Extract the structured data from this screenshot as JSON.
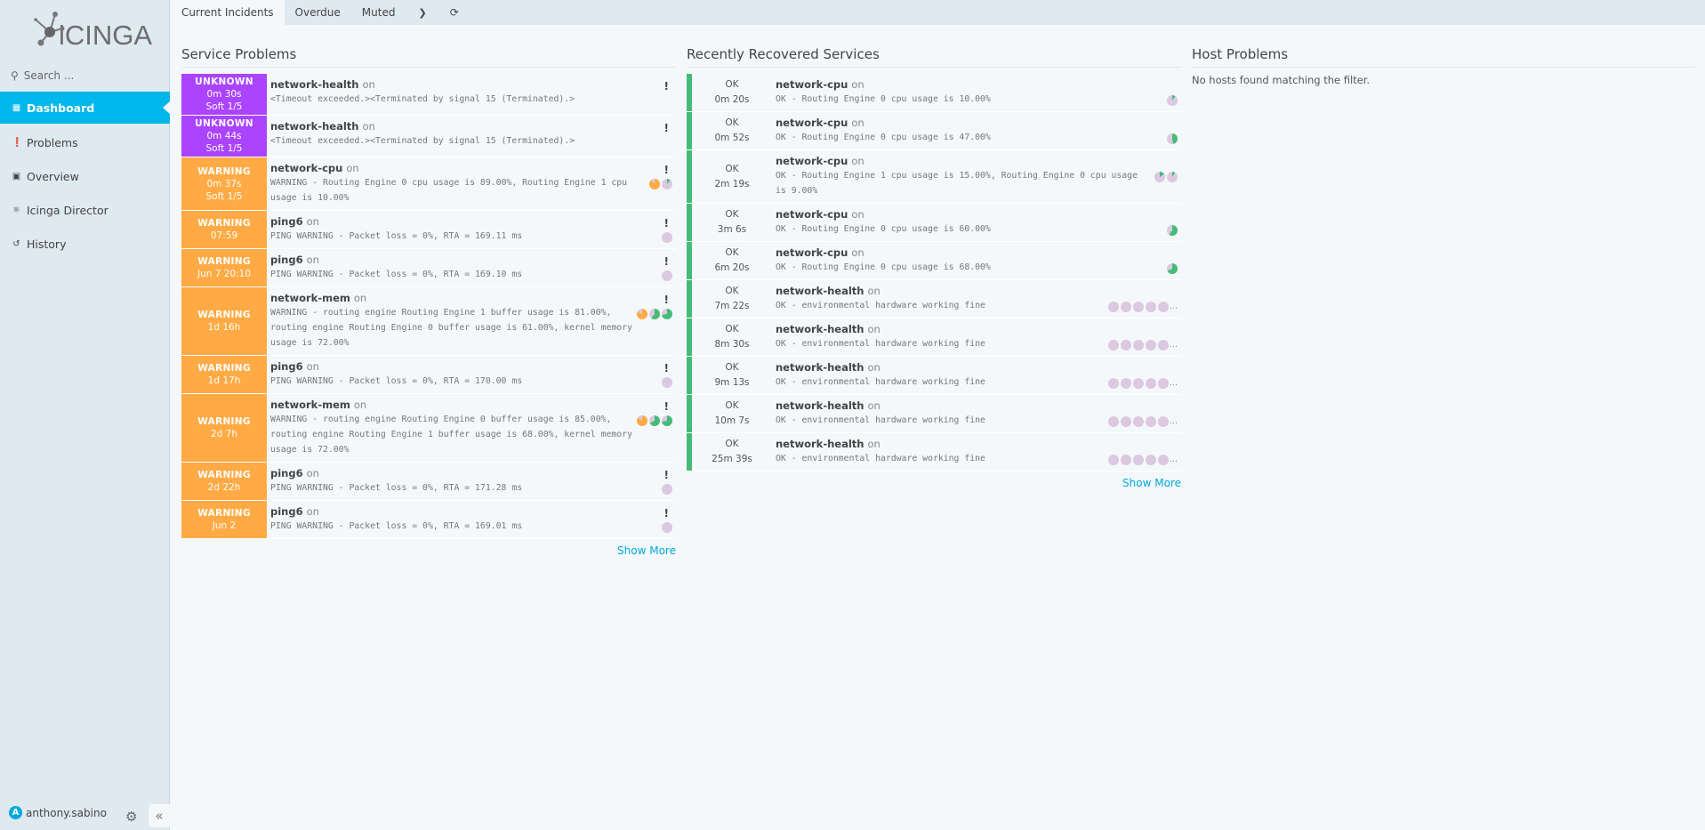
{
  "sidebar": {
    "logo_text": "iCINGA",
    "search_placeholder": "Search ...",
    "items": [
      {
        "label": "Dashboard",
        "icon": "dashboard-icon",
        "active": true
      },
      {
        "label": "Problems",
        "icon": "problems-icon"
      },
      {
        "label": "Overview",
        "icon": "binoculars-icon"
      },
      {
        "label": "Icinga Director",
        "icon": "director-icon"
      },
      {
        "label": "History",
        "icon": "history-icon"
      }
    ],
    "user": {
      "initial": "A",
      "name": "anthony.sabino"
    }
  },
  "tabs": [
    {
      "label": "Current Incidents",
      "active": true
    },
    {
      "label": "Overdue"
    },
    {
      "label": "Muted"
    }
  ],
  "colors": {
    "unknown": "#aa44ff",
    "warning": "#ffaa44",
    "ok": "#44bb77",
    "accent": "#00b7eb",
    "pie_bg": "#dcc8e0"
  },
  "service_problems": {
    "title": "Service Problems",
    "show_more": "Show More",
    "rows": [
      {
        "state": "UNKNOWN",
        "since": "0m 30s",
        "soft": "Soft 1/5",
        "service": "network-health",
        "on": "on",
        "output": "<Timeout exceeded.><Terminated by signal 15 (Terminated).>",
        "perf": []
      },
      {
        "state": "UNKNOWN",
        "since": "0m 44s",
        "soft": "Soft 1/5",
        "service": "network-health",
        "on": "on",
        "output": "<Timeout exceeded.><Terminated by signal 15 (Terminated).>",
        "perf": []
      },
      {
        "state": "WARNING",
        "since": "0m 37s",
        "soft": "Soft 1/5",
        "service": "network-cpu",
        "on": "on",
        "output": "WARNING - Routing Engine 0 cpu usage is 89.00%, Routing Engine 1 cpu usage is 10.00%",
        "perf": [
          {
            "value": 89,
            "color": "#ffaa44"
          },
          {
            "value": 10,
            "color": "#44bb77"
          }
        ]
      },
      {
        "state": "WARNING",
        "since": "07:59",
        "soft": "",
        "service": "ping6",
        "on": "on",
        "output": "PING WARNING - Packet loss = 0%, RTA = 169.11 ms",
        "perf": [
          {
            "value": 0,
            "color": "#44bb77"
          }
        ]
      },
      {
        "state": "WARNING",
        "since": "Jun 7 20:10",
        "soft": "",
        "service": "ping6",
        "on": "on",
        "output": "PING WARNING - Packet loss = 0%, RTA = 169.10 ms",
        "perf": [
          {
            "value": 0,
            "color": "#44bb77"
          }
        ]
      },
      {
        "state": "WARNING",
        "since": "1d 16h",
        "soft": "",
        "service": "network-mem",
        "on": "on",
        "output": "WARNING - routing engine Routing Engine 1 buffer usage is 81.00%, routing engine Routing Engine 0 buffer usage is 61.00%, kernel memory usage is 72.00%",
        "perf": [
          {
            "value": 81,
            "color": "#ffaa44"
          },
          {
            "value": 61,
            "color": "#44bb77"
          },
          {
            "value": 72,
            "color": "#44bb77"
          }
        ]
      },
      {
        "state": "WARNING",
        "since": "1d 17h",
        "soft": "",
        "service": "ping6",
        "on": "on",
        "output": "PING WARNING - Packet loss = 0%, RTA = 170.00 ms",
        "perf": [
          {
            "value": 0,
            "color": "#44bb77"
          }
        ]
      },
      {
        "state": "WARNING",
        "since": "2d 7h",
        "soft": "",
        "service": "network-mem",
        "on": "on",
        "output": "WARNING - routing engine Routing Engine 0 buffer usage is 85.00%, routing engine Routing Engine 1 buffer usage is 68.00%, kernel memory usage is 72.00%",
        "perf": [
          {
            "value": 85,
            "color": "#ffaa44"
          },
          {
            "value": 68,
            "color": "#44bb77"
          },
          {
            "value": 72,
            "color": "#44bb77"
          }
        ]
      },
      {
        "state": "WARNING",
        "since": "2d 22h",
        "soft": "",
        "service": "ping6",
        "on": "on",
        "output": "PING WARNING - Packet loss = 0%, RTA = 171.28 ms",
        "perf": [
          {
            "value": 0,
            "color": "#44bb77"
          }
        ]
      },
      {
        "state": "WARNING",
        "since": "Jun 2",
        "soft": "",
        "service": "ping6",
        "on": "on",
        "output": "PING WARNING - Packet loss = 0%, RTA = 169.01 ms",
        "perf": [
          {
            "value": 0,
            "color": "#44bb77"
          }
        ]
      }
    ]
  },
  "recovered": {
    "title": "Recently Recovered Services",
    "show_more": "Show More",
    "rows": [
      {
        "state": "OK",
        "since": "0m 20s",
        "service": "network-cpu",
        "on": "on",
        "output": "OK - Routing Engine 0 cpu usage is 10.00%",
        "perf": [
          {
            "value": 10,
            "color": "#44bb77"
          }
        ]
      },
      {
        "state": "OK",
        "since": "0m 52s",
        "service": "network-cpu",
        "on": "on",
        "output": "OK - Routing Engine 0 cpu usage is 47.00%",
        "perf": [
          {
            "value": 47,
            "color": "#44bb77"
          }
        ]
      },
      {
        "state": "OK",
        "since": "2m 19s",
        "service": "network-cpu",
        "on": "on",
        "output": "OK - Routing Engine 1 cpu usage is 15.00%, Routing Engine 0 cpu usage is 9.00%",
        "perf": [
          {
            "value": 15,
            "color": "#44bb77"
          },
          {
            "value": 9,
            "color": "#44bb77"
          }
        ]
      },
      {
        "state": "OK",
        "since": "3m 6s",
        "service": "network-cpu",
        "on": "on",
        "output": "OK - Routing Engine 0 cpu usage is 60.00%",
        "perf": [
          {
            "value": 60,
            "color": "#44bb77"
          }
        ]
      },
      {
        "state": "OK",
        "since": "6m 20s",
        "service": "network-cpu",
        "on": "on",
        "output": "OK - Routing Engine 0 cpu usage is 68.00%",
        "perf": [
          {
            "value": 68,
            "color": "#44bb77"
          }
        ]
      },
      {
        "state": "OK",
        "since": "7m 22s",
        "service": "network-health",
        "on": "on",
        "output": "OK - environmental hardware working fine",
        "perf": [
          {
            "value": 0
          },
          {
            "value": 0
          },
          {
            "value": 0
          },
          {
            "value": 0
          },
          {
            "value": 0
          }
        ],
        "more": true
      },
      {
        "state": "OK",
        "since": "8m 30s",
        "service": "network-health",
        "on": "on",
        "output": "OK - environmental hardware working fine",
        "perf": [
          {
            "value": 0
          },
          {
            "value": 0
          },
          {
            "value": 0
          },
          {
            "value": 0
          },
          {
            "value": 0
          }
        ],
        "more": true
      },
      {
        "state": "OK",
        "since": "9m 13s",
        "service": "network-health",
        "on": "on",
        "output": "OK - environmental hardware working fine",
        "perf": [
          {
            "value": 0
          },
          {
            "value": 0
          },
          {
            "value": 0
          },
          {
            "value": 0
          },
          {
            "value": 0
          }
        ],
        "more": true
      },
      {
        "state": "OK",
        "since": "10m 7s",
        "service": "network-health",
        "on": "on",
        "output": "OK - environmental hardware working fine",
        "perf": [
          {
            "value": 0
          },
          {
            "value": 0
          },
          {
            "value": 0
          },
          {
            "value": 0
          },
          {
            "value": 0
          }
        ],
        "more": true
      },
      {
        "state": "OK",
        "since": "25m 39s",
        "service": "network-health",
        "on": "on",
        "output": "OK - environmental hardware working fine",
        "perf": [
          {
            "value": 0
          },
          {
            "value": 0
          },
          {
            "value": 0
          },
          {
            "value": 0
          },
          {
            "value": 0
          }
        ],
        "more": true
      }
    ]
  },
  "host_problems": {
    "title": "Host Problems",
    "empty": "No hosts found matching the filter."
  }
}
